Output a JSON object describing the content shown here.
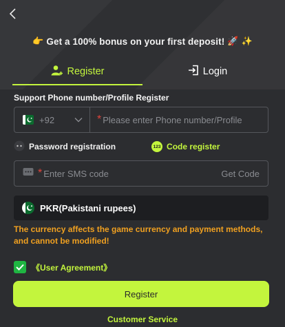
{
  "header": {
    "promo_text": "Get a 100% bonus on your first deposit!",
    "promo_icons": [
      "pointing-hand-icon",
      "rocket-icon",
      "sparkles-icon"
    ]
  },
  "tabs": [
    {
      "label": "Register",
      "active": true,
      "icon": "add-user-icon"
    },
    {
      "label": "Login",
      "active": false,
      "icon": "login-icon"
    }
  ],
  "phone": {
    "label": "Support Phone number/Profile Register",
    "country_code": "+92",
    "flag": "pakistan-flag-icon",
    "placeholder": "Please enter Phone number/Profile",
    "required_mark": "*"
  },
  "methods": {
    "password_label": "Password registration",
    "code_label": "Code register",
    "code_icon_text": "123"
  },
  "sms": {
    "placeholder": "Enter SMS code",
    "required_mark": "*",
    "get_code_label": "Get Code"
  },
  "currency": {
    "value": "PKR(Pakistani rupees)",
    "flag": "pakistan-flag-icon"
  },
  "warning": "The currency affects the game currency and payment methods, and cannot be modified!",
  "agreement": {
    "checked": true,
    "label": "《User Agreement》"
  },
  "register_button": "Register",
  "customer_service": "Customer Service",
  "colors": {
    "accent": "#c3f53d",
    "background": "#2c2d30",
    "warning": "#f0a020",
    "checkbox": "#1fb542",
    "required": "#e0443c"
  }
}
